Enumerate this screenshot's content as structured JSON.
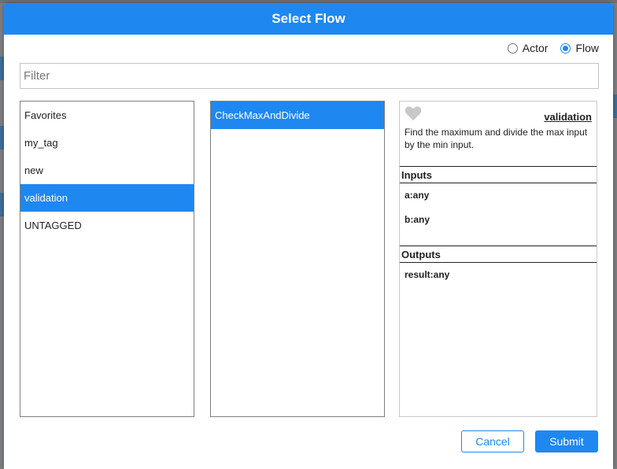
{
  "dialog": {
    "title": "Select Flow"
  },
  "mode": {
    "options": [
      {
        "label": "Actor",
        "checked": false
      },
      {
        "label": "Flow",
        "checked": true
      }
    ]
  },
  "filter": {
    "placeholder": "Filter",
    "value": ""
  },
  "tags": {
    "items": [
      "Favorites",
      "my_tag",
      "new",
      "validation",
      "UNTAGGED"
    ],
    "selected": "validation"
  },
  "flows": {
    "items": [
      "CheckMaxAndDivide"
    ],
    "selected": "CheckMaxAndDivide"
  },
  "details": {
    "favorite_icon": "heart-icon",
    "tag": "validation",
    "description": "Find the maximum and divide the max input by the min input.",
    "inputs_title": "Inputs",
    "inputs": [
      "a:any",
      "b:any"
    ],
    "outputs_title": "Outputs",
    "outputs": [
      "result:any"
    ]
  },
  "buttons": {
    "cancel": "Cancel",
    "submit": "Submit"
  },
  "colors": {
    "accent": "#1e88f0"
  }
}
